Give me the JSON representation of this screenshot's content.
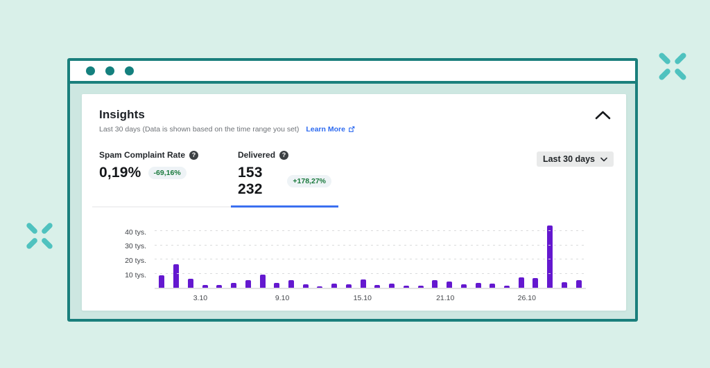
{
  "decor": {
    "sparkle_color": "#4fc2bf"
  },
  "window": {
    "dot_count": 3,
    "frame_color": "#1a7f7c",
    "inner_background": "#cde7e1"
  },
  "card": {
    "title": "Insights",
    "subtitle": "Last 30 days (Data is shown based on the time range you set)",
    "learn_more_label": "Learn More",
    "collapse_icon": "chevron-up"
  },
  "tabs": [
    {
      "label": "Spam Complaint Rate",
      "value": "0,19%",
      "delta": "-69,16%",
      "active": false
    },
    {
      "label": "Delivered",
      "value": "153 232",
      "delta": "+178,27%",
      "active": true
    }
  ],
  "range_select": {
    "value": "Last 30 days"
  },
  "colors": {
    "bar_purple": "#6418cf",
    "indicator_blue": "#3b6ff0",
    "link_blue": "#2e6bf0",
    "badge_green": "#19793c",
    "badge_background": "#eef3f6",
    "background_mint": "#d9f0e9"
  },
  "chart_data": {
    "type": "bar",
    "title": "Delivered",
    "y_unit": "tys.",
    "ylim": [
      0,
      47
    ],
    "grid": "dashed-horizontal",
    "bar_color": "#6418cf",
    "values": [
      9.0,
      16.5,
      6.6,
      1.9,
      2.2,
      3.4,
      5.3,
      9.3,
      3.2,
      5.5,
      2.7,
      1.1,
      3.0,
      2.7,
      5.8,
      1.9,
      3.1,
      1.3,
      1.6,
      5.5,
      4.4,
      2.7,
      3.5,
      3.1,
      1.3,
      7.5,
      7.1,
      43.9,
      3.9,
      5.5
    ],
    "y_ticks": [
      {
        "value": 10,
        "label": "10 tys."
      },
      {
        "value": 20,
        "label": "20 tys."
      },
      {
        "value": 30,
        "label": "30 tys."
      },
      {
        "value": 40,
        "label": "40 tys."
      }
    ],
    "x_ticks": [
      {
        "label": "3.10",
        "pos_pct": 10.6
      },
      {
        "label": "9.10",
        "pos_pct": 29.6
      },
      {
        "label": "15.10",
        "pos_pct": 48.2
      },
      {
        "label": "21.10",
        "pos_pct": 67.4
      },
      {
        "label": "26.10",
        "pos_pct": 86.3
      }
    ]
  }
}
